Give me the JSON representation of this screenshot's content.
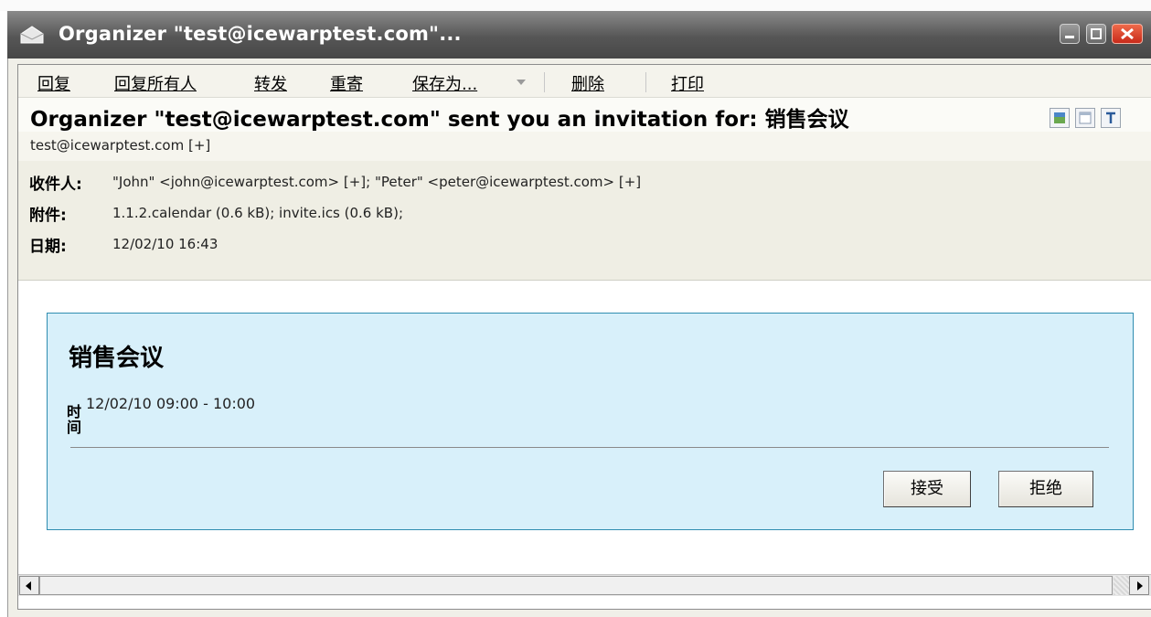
{
  "window": {
    "title": "Organizer \"test@icewarptest.com\"..."
  },
  "toolbar": {
    "items": [
      "回复",
      "回复所有人",
      "转发",
      "重寄",
      "保存为...",
      "删除",
      "打印"
    ]
  },
  "message": {
    "subject": "Organizer \"test@icewarptest.com\" sent you an invitation for: 销售会议",
    "sender": "test@icewarptest.com [+]",
    "fields": [
      {
        "label": "收件人:",
        "value": "\"John\" <john@icewarptest.com> [+]; \"Peter\" <peter@icewarptest.com> [+]"
      },
      {
        "label": "附件:",
        "value": "1.1.2.calendar (0.6 kB); invite.ics (0.6 kB);"
      },
      {
        "label": "日期:",
        "value": "12/02/10 16:43"
      }
    ]
  },
  "invitation": {
    "title": "销售会议",
    "time_label": "时间",
    "time_value": "12/02/10 09:00 - 10:00",
    "accept_label": "接受",
    "decline_label": "拒绝"
  },
  "colors": {
    "titlebar": "#565656",
    "invite_background": "#d8f0fa",
    "invite_border": "#2f8db0",
    "close_button": "#c82a1a"
  },
  "icons": [
    "envelope-icon",
    "minimize-icon",
    "maximize-icon",
    "close-icon",
    "image-view-icon",
    "html-view-icon",
    "text-view-icon",
    "scroll-left-icon",
    "scroll-right-icon"
  ]
}
